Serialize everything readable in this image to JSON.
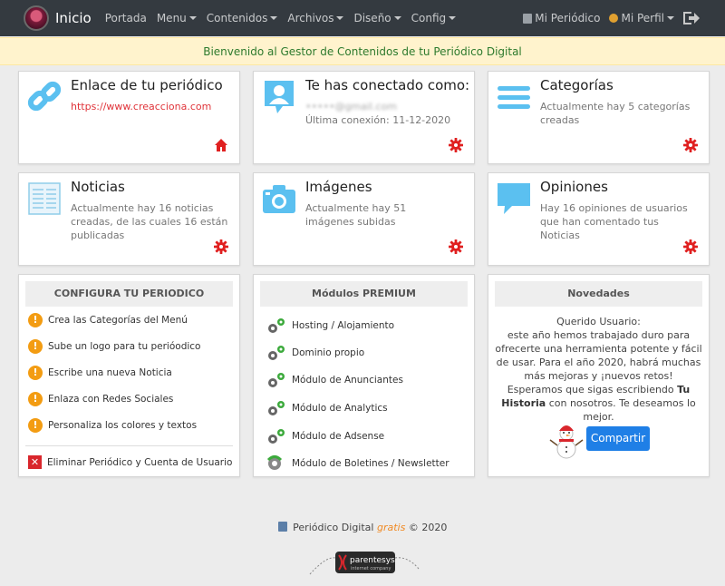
{
  "navbar": {
    "brand_label": "Inicio",
    "items": [
      {
        "label": "Portada",
        "dropdown": false
      },
      {
        "label": "Menu",
        "dropdown": true
      },
      {
        "label": "Contenidos",
        "dropdown": true
      },
      {
        "label": "Archivos",
        "dropdown": true
      },
      {
        "label": "Diseño",
        "dropdown": true
      },
      {
        "label": "Config",
        "dropdown": true
      }
    ],
    "right": {
      "periodico_label": "Mi Periódico",
      "perfil_label": "Mi Perfil"
    }
  },
  "banner": {
    "text": "Bienvenido al Gestor de Contenidos de tu Periódico Digital"
  },
  "cards": {
    "enlace": {
      "title": "Enlace de tu periódico",
      "link": "https://www.creacciona.com",
      "icon": "link-icon",
      "action_icon": "home-icon"
    },
    "conectado": {
      "title": "Te has conectado como:",
      "email": "•••••@gmail.com",
      "last_login": "Última conexión: 11-12-2020",
      "icon": "user-icon",
      "action_icon": "gear-icon"
    },
    "categorias": {
      "title": "Categorías",
      "text": "Actualmente hay 5 categorías creadas",
      "icon": "menu-icon",
      "action_icon": "gear-icon"
    },
    "noticias": {
      "title": "Noticias",
      "text": "Actualmente hay 16 noticias creadas, de las cuales 16 están publicadas",
      "icon": "newspaper-icon",
      "action_icon": "gear-icon"
    },
    "imagenes": {
      "title": "Imágenes",
      "text": "Actualmente hay 51 imágenes subidas",
      "icon": "camera-icon",
      "action_icon": "gear-icon"
    },
    "opiniones": {
      "title": "Opiniones",
      "text": "Hay 16 opiniones de usuarios que han comentado tus Noticias",
      "icon": "comment-icon",
      "action_icon": "gear-icon"
    }
  },
  "configura": {
    "title": "CONFIGURA TU PERIODICO",
    "items": [
      "Crea las Categorías del Menú",
      "Sube un logo para tu perióodico",
      "Escribe una nueva Noticia",
      "Enlaza con Redes Sociales",
      "Personaliza los colores y textos"
    ],
    "delete_label": "Eliminar Periódico y Cuenta de Usuario"
  },
  "premium": {
    "title": "Módulos PREMIUM",
    "items": [
      "Hosting / Alojamiento",
      "Dominio propio",
      "Módulo de Anunciantes",
      "Módulo de Analytics",
      "Módulo de Adsense",
      "Módulo de Boletines / Newsletter"
    ]
  },
  "novedades": {
    "title": "Novedades",
    "greeting": "Querido Usuario:",
    "message": "este año hemos trabajado duro para ofrecerte una herramienta potente y fácil de usar. Para el año 2020, habrá muchas más mejoras y ¡nuevos retos!",
    "closing_pre": "Esperamos que sigas escribiendo ",
    "closing_bold": "Tu Historia",
    "closing_post": " con nosotros. Te deseamos lo mejor.",
    "share_label": "Compartir"
  },
  "footer": {
    "brand": "Periódico Digital",
    "gratis": "gratis",
    "copyright": "© 2020",
    "logo_text": "parentesys",
    "logo_subtext": "internet company"
  },
  "colors": {
    "navbar": "#343a40",
    "banner_bg": "#fff3cd",
    "banner_text": "#2d7a2d",
    "icon_blue": "#5bc0f0",
    "action_red": "#e02020",
    "warn_orange": "#f39c12",
    "share_blue": "#1f7fe6"
  }
}
